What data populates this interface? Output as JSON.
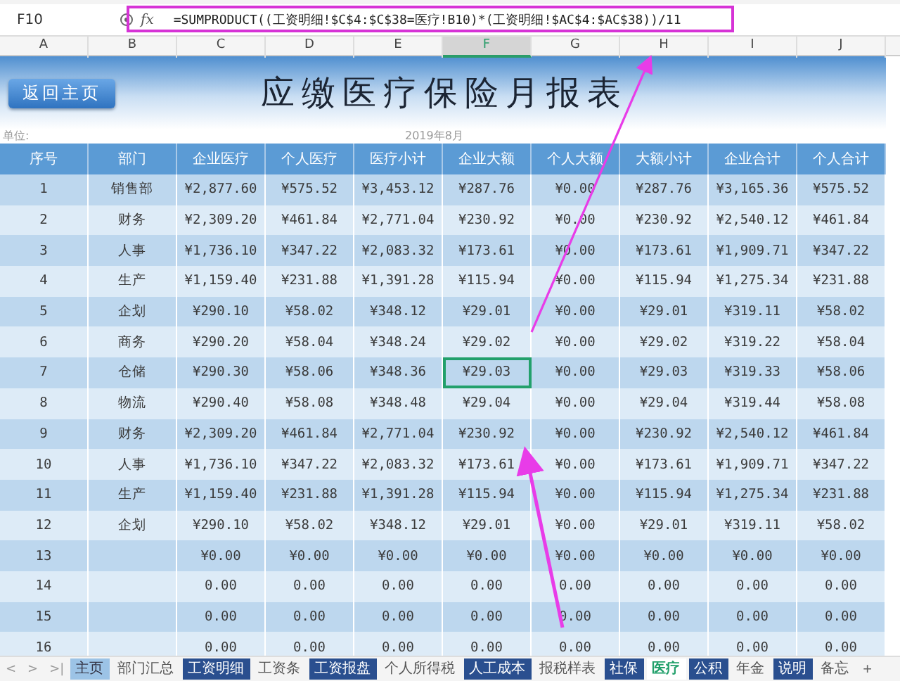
{
  "formula_bar": {
    "name_box": "F10",
    "fx": "fx",
    "formula": "=SUMPRODUCT((工资明细!$C$4:$C$38=医疗!B10)*(工资明细!$AC$4:$AC$38))/11"
  },
  "column_headers": [
    {
      "label": "A",
      "selected": false
    },
    {
      "label": "B",
      "selected": false
    },
    {
      "label": "C",
      "selected": false
    },
    {
      "label": "D",
      "selected": false
    },
    {
      "label": "E",
      "selected": false
    },
    {
      "label": "F",
      "selected": true
    },
    {
      "label": "G",
      "selected": false
    },
    {
      "label": "H",
      "selected": false
    },
    {
      "label": "I",
      "selected": false
    },
    {
      "label": "J",
      "selected": false
    }
  ],
  "banner": {
    "button": "返回主页",
    "title": "应缴医疗保险月报表"
  },
  "unit_label": "单位:",
  "period": "2019年8月",
  "table": {
    "columns": [
      "序号",
      "部门",
      "企业医疗",
      "个人医疗",
      "医疗小计",
      "企业大额",
      "个人大额",
      "大额小计",
      "企业合计",
      "个人合计"
    ],
    "rows": [
      {
        "no": "1",
        "dept": "销售部",
        "values": [
          "¥2,877.60",
          "¥575.52",
          "¥3,453.12",
          "¥287.76",
          "¥0.00",
          "¥287.76",
          "¥3,165.36",
          "¥575.52"
        ],
        "selected": false
      },
      {
        "no": "2",
        "dept": "财务",
        "values": [
          "¥2,309.20",
          "¥461.84",
          "¥2,771.04",
          "¥230.92",
          "¥0.00",
          "¥230.92",
          "¥2,540.12",
          "¥461.84"
        ],
        "selected": false
      },
      {
        "no": "3",
        "dept": "人事",
        "values": [
          "¥1,736.10",
          "¥347.22",
          "¥2,083.32",
          "¥173.61",
          "¥0.00",
          "¥173.61",
          "¥1,909.71",
          "¥347.22"
        ],
        "selected": false
      },
      {
        "no": "4",
        "dept": "生产",
        "values": [
          "¥1,159.40",
          "¥231.88",
          "¥1,391.28",
          "¥115.94",
          "¥0.00",
          "¥115.94",
          "¥1,275.34",
          "¥231.88"
        ],
        "selected": false
      },
      {
        "no": "5",
        "dept": "企划",
        "values": [
          "¥290.10",
          "¥58.02",
          "¥348.12",
          "¥29.01",
          "¥0.00",
          "¥29.01",
          "¥319.11",
          "¥58.02"
        ],
        "selected": false
      },
      {
        "no": "6",
        "dept": "商务",
        "values": [
          "¥290.20",
          "¥58.04",
          "¥348.24",
          "¥29.02",
          "¥0.00",
          "¥29.02",
          "¥319.22",
          "¥58.04"
        ],
        "selected": false
      },
      {
        "no": "7",
        "dept": "仓储",
        "values": [
          "¥290.30",
          "¥58.06",
          "¥348.36",
          "¥29.03",
          "¥0.00",
          "¥29.03",
          "¥319.33",
          "¥58.06"
        ],
        "selected": true
      },
      {
        "no": "8",
        "dept": "物流",
        "values": [
          "¥290.40",
          "¥58.08",
          "¥348.48",
          "¥29.04",
          "¥0.00",
          "¥29.04",
          "¥319.44",
          "¥58.08"
        ],
        "selected": false
      },
      {
        "no": "9",
        "dept": "财务",
        "values": [
          "¥2,309.20",
          "¥461.84",
          "¥2,771.04",
          "¥230.92",
          "¥0.00",
          "¥230.92",
          "¥2,540.12",
          "¥461.84"
        ],
        "selected": false
      },
      {
        "no": "10",
        "dept": "人事",
        "values": [
          "¥1,736.10",
          "¥347.22",
          "¥2,083.32",
          "¥173.61",
          "¥0.00",
          "¥173.61",
          "¥1,909.71",
          "¥347.22"
        ],
        "selected": false
      },
      {
        "no": "11",
        "dept": "生产",
        "values": [
          "¥1,159.40",
          "¥231.88",
          "¥1,391.28",
          "¥115.94",
          "¥0.00",
          "¥115.94",
          "¥1,275.34",
          "¥231.88"
        ],
        "selected": false
      },
      {
        "no": "12",
        "dept": "企划",
        "values": [
          "¥290.10",
          "¥58.02",
          "¥348.12",
          "¥29.01",
          "¥0.00",
          "¥29.01",
          "¥319.11",
          "¥58.02"
        ],
        "selected": false
      },
      {
        "no": "13",
        "values": [
          "¥0.00",
          "¥0.00",
          "¥0.00",
          "¥0.00",
          "¥0.00",
          "¥0.00",
          "¥0.00",
          "¥0.00"
        ],
        "selected": false
      },
      {
        "no": "14",
        "values": [
          "0.00",
          "0.00",
          "0.00",
          "0.00",
          "0.00",
          "0.00",
          "0.00",
          "0.00"
        ],
        "selected": false
      },
      {
        "no": "15",
        "values": [
          "0.00",
          "0.00",
          "0.00",
          "0.00",
          "0.00",
          "0.00",
          "0.00",
          "0.00"
        ],
        "selected": false
      },
      {
        "no": "16",
        "values": [
          "0.00",
          "0.00",
          "0.00",
          "0.00",
          "0.00",
          "0.00",
          "0.00",
          "0.00"
        ],
        "selected": false
      }
    ]
  },
  "sheet_nav": [
    "<",
    ">",
    ">|"
  ],
  "sheet_tabs": [
    {
      "label": "主页",
      "kind": "light",
      "selected": false
    },
    {
      "label": "部门汇总",
      "kind": "plain",
      "selected": false
    },
    {
      "label": "工资明细",
      "kind": "dark",
      "selected": false
    },
    {
      "label": "工资条",
      "kind": "plain",
      "selected": false
    },
    {
      "label": "工资报盘",
      "kind": "dark",
      "selected": false
    },
    {
      "label": "个人所得税",
      "kind": "plain",
      "selected": false
    },
    {
      "label": "人工成本",
      "kind": "dark",
      "selected": false
    },
    {
      "label": "报税样表",
      "kind": "plain",
      "selected": false
    },
    {
      "label": "社保",
      "kind": "dark",
      "selected": false
    },
    {
      "label": "医疗",
      "kind": "plain",
      "selected": true
    },
    {
      "label": "公积",
      "kind": "dark",
      "selected": false
    },
    {
      "label": "年金",
      "kind": "plain",
      "selected": false
    },
    {
      "label": "说明",
      "kind": "dark",
      "selected": false
    },
    {
      "label": "备忘",
      "kind": "plain",
      "selected": false
    }
  ],
  "add_sheet": "+"
}
